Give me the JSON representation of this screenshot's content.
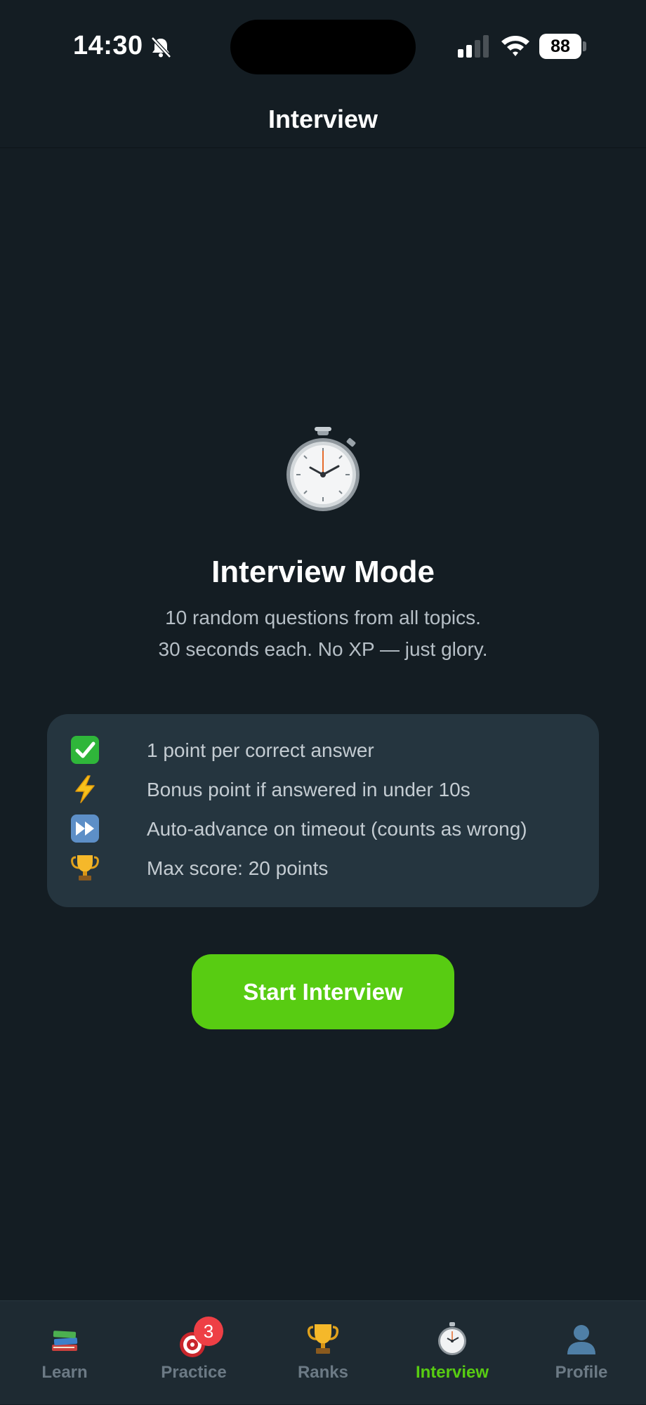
{
  "status_bar": {
    "time": "14:30",
    "battery": "88",
    "icons": [
      "bell-slash-icon",
      "cellular-signal-icon",
      "wifi-icon",
      "battery-icon"
    ]
  },
  "header": {
    "title": "Interview"
  },
  "main": {
    "hero_icon": "stopwatch-icon",
    "title": "Interview Mode",
    "description_line1": "10 random questions from all topics.",
    "description_line2": "30 seconds each. No XP — just glory.",
    "rules": [
      {
        "icon": "check-mark-icon",
        "text": "1 point per correct answer"
      },
      {
        "icon": "lightning-icon",
        "text": "Bonus point if answered in under 10s"
      },
      {
        "icon": "fast-forward-icon",
        "text": "Auto-advance on timeout (counts as wrong)"
      },
      {
        "icon": "trophy-icon",
        "text": "Max score: 20 points"
      }
    ],
    "start_button": "Start Interview"
  },
  "tab_bar": {
    "tabs": [
      {
        "label": "Learn",
        "icon": "books-icon",
        "active": false
      },
      {
        "label": "Practice",
        "icon": "target-icon",
        "active": false,
        "badge": "3"
      },
      {
        "label": "Ranks",
        "icon": "trophy-icon",
        "active": false
      },
      {
        "label": "Interview",
        "icon": "stopwatch-icon",
        "active": true
      },
      {
        "label": "Profile",
        "icon": "person-silhouette-icon",
        "active": false
      }
    ]
  },
  "colors": {
    "background": "#141d23",
    "card": "#25353f",
    "accent_green": "#58cc12",
    "badge_red": "#ee3f45",
    "tab_inactive": "#6c7a85"
  }
}
